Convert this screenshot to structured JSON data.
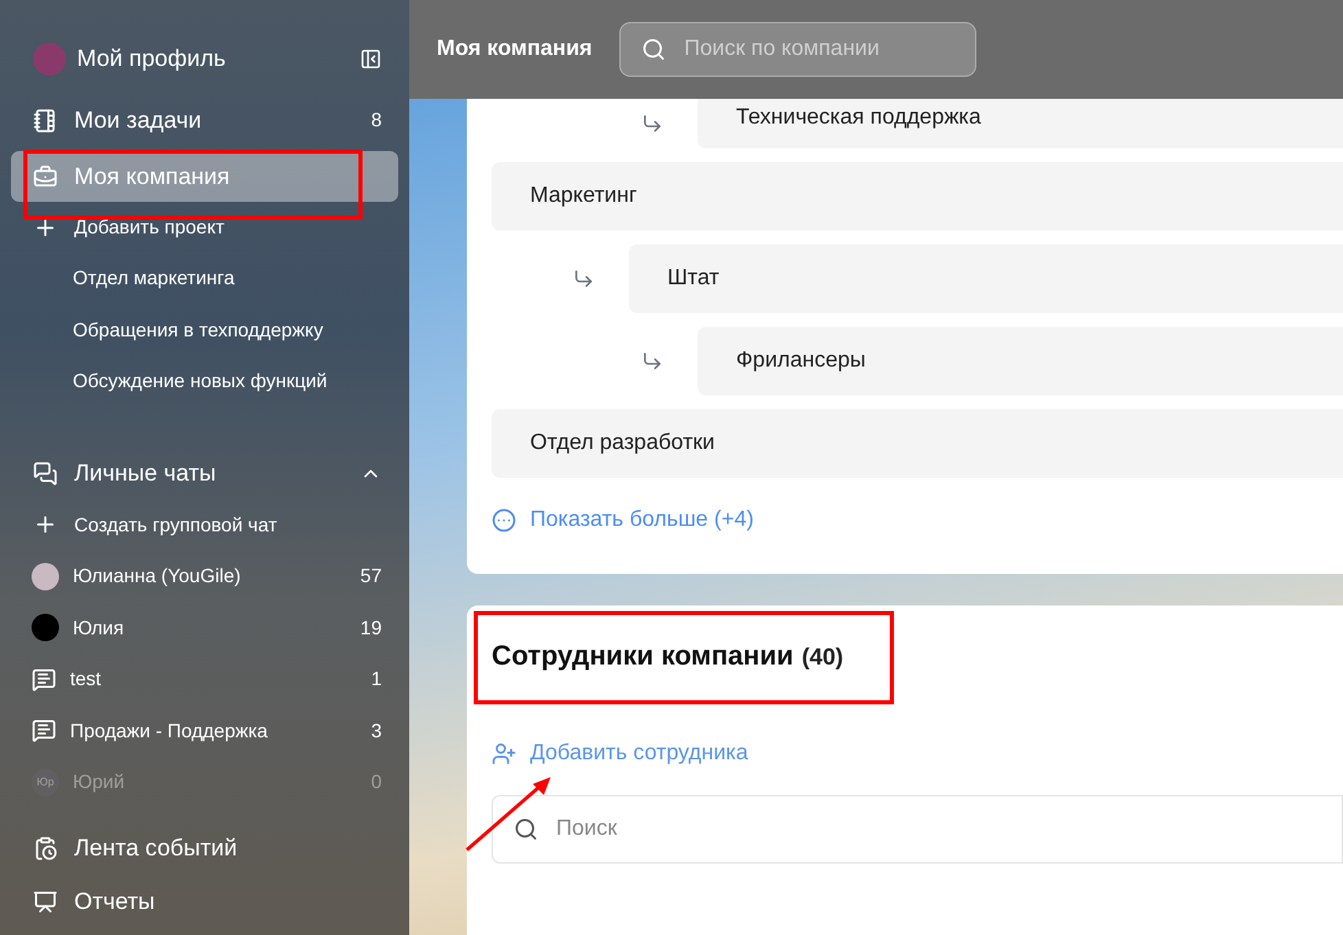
{
  "sidebar": {
    "profile": {
      "name": "Мой профиль"
    },
    "nav": [
      {
        "kind": "tasks",
        "label": "Мои задачи",
        "count": "8",
        "selected": false
      },
      {
        "kind": "company",
        "label": "Моя компания",
        "selected": true
      }
    ],
    "add_project": "Добавить проект",
    "projects": [
      "Отдел маркетинга",
      "Обращения в техподдержку",
      "Обсуждение новых функций"
    ],
    "chats": {
      "title": "Личные чаты",
      "expanded": true,
      "create": "Создать групповой чат",
      "items": [
        {
          "kind": "photo",
          "name": "Юлианна (YouGile)",
          "count": "57",
          "dimmed": false
        },
        {
          "kind": "photo-dark",
          "name": "Юлия",
          "count": "19",
          "dimmed": false
        },
        {
          "kind": "group",
          "name": "test",
          "count": "1",
          "dimmed": false
        },
        {
          "kind": "group",
          "name": "Продажи - Поддержка",
          "count": "3",
          "dimmed": false
        },
        {
          "kind": "initials",
          "initials": "Юр",
          "name": "Юрий",
          "count": "0",
          "dimmed": true
        }
      ]
    },
    "bottom": [
      {
        "kind": "feed",
        "label": "Лента событий"
      },
      {
        "kind": "reports",
        "label": "Отчеты"
      }
    ]
  },
  "header": {
    "title": "Моя компания",
    "search_placeholder": "Поиск по компании"
  },
  "departments": [
    {
      "children": [
        {
          "children": [
            {
              "name": "Техническая поддержка"
            }
          ]
        }
      ]
    },
    {
      "name": "Маркетинг",
      "children": [
        {
          "name": "Штат",
          "children": [
            {
              "name": "Фрилансеры"
            }
          ]
        }
      ]
    },
    {
      "name": "Отдел разработки"
    }
  ],
  "show_more": "Показать больше (+4)",
  "employees": {
    "title": "Сотрудники компании",
    "count": "(40)",
    "add": "Добавить сотрудника",
    "search_placeholder": "Поиск"
  }
}
